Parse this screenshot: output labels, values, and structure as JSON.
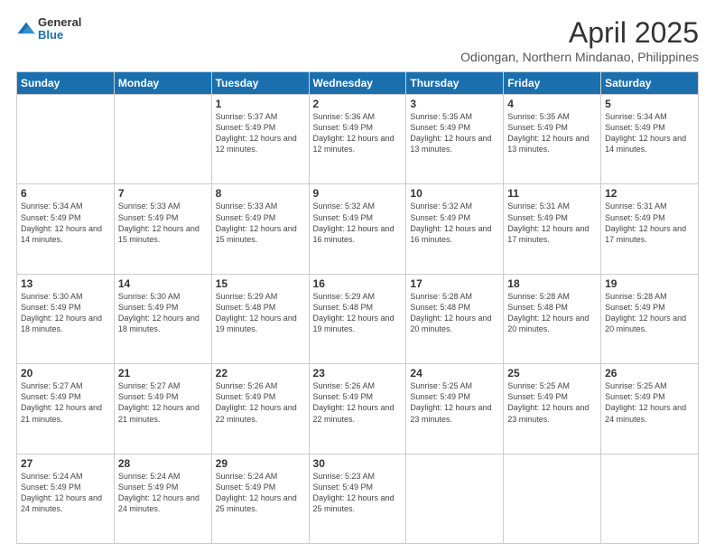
{
  "header": {
    "logo_general": "General",
    "logo_blue": "Blue",
    "title": "April 2025",
    "subtitle": "Odiongan, Northern Mindanao, Philippines"
  },
  "days_of_week": [
    "Sunday",
    "Monday",
    "Tuesday",
    "Wednesday",
    "Thursday",
    "Friday",
    "Saturday"
  ],
  "weeks": [
    [
      {
        "day": "",
        "info": ""
      },
      {
        "day": "",
        "info": ""
      },
      {
        "day": "1",
        "info": "Sunrise: 5:37 AM\nSunset: 5:49 PM\nDaylight: 12 hours and 12 minutes."
      },
      {
        "day": "2",
        "info": "Sunrise: 5:36 AM\nSunset: 5:49 PM\nDaylight: 12 hours and 12 minutes."
      },
      {
        "day": "3",
        "info": "Sunrise: 5:35 AM\nSunset: 5:49 PM\nDaylight: 12 hours and 13 minutes."
      },
      {
        "day": "4",
        "info": "Sunrise: 5:35 AM\nSunset: 5:49 PM\nDaylight: 12 hours and 13 minutes."
      },
      {
        "day": "5",
        "info": "Sunrise: 5:34 AM\nSunset: 5:49 PM\nDaylight: 12 hours and 14 minutes."
      }
    ],
    [
      {
        "day": "6",
        "info": "Sunrise: 5:34 AM\nSunset: 5:49 PM\nDaylight: 12 hours and 14 minutes."
      },
      {
        "day": "7",
        "info": "Sunrise: 5:33 AM\nSunset: 5:49 PM\nDaylight: 12 hours and 15 minutes."
      },
      {
        "day": "8",
        "info": "Sunrise: 5:33 AM\nSunset: 5:49 PM\nDaylight: 12 hours and 15 minutes."
      },
      {
        "day": "9",
        "info": "Sunrise: 5:32 AM\nSunset: 5:49 PM\nDaylight: 12 hours and 16 minutes."
      },
      {
        "day": "10",
        "info": "Sunrise: 5:32 AM\nSunset: 5:49 PM\nDaylight: 12 hours and 16 minutes."
      },
      {
        "day": "11",
        "info": "Sunrise: 5:31 AM\nSunset: 5:49 PM\nDaylight: 12 hours and 17 minutes."
      },
      {
        "day": "12",
        "info": "Sunrise: 5:31 AM\nSunset: 5:49 PM\nDaylight: 12 hours and 17 minutes."
      }
    ],
    [
      {
        "day": "13",
        "info": "Sunrise: 5:30 AM\nSunset: 5:49 PM\nDaylight: 12 hours and 18 minutes."
      },
      {
        "day": "14",
        "info": "Sunrise: 5:30 AM\nSunset: 5:49 PM\nDaylight: 12 hours and 18 minutes."
      },
      {
        "day": "15",
        "info": "Sunrise: 5:29 AM\nSunset: 5:48 PM\nDaylight: 12 hours and 19 minutes."
      },
      {
        "day": "16",
        "info": "Sunrise: 5:29 AM\nSunset: 5:48 PM\nDaylight: 12 hours and 19 minutes."
      },
      {
        "day": "17",
        "info": "Sunrise: 5:28 AM\nSunset: 5:48 PM\nDaylight: 12 hours and 20 minutes."
      },
      {
        "day": "18",
        "info": "Sunrise: 5:28 AM\nSunset: 5:48 PM\nDaylight: 12 hours and 20 minutes."
      },
      {
        "day": "19",
        "info": "Sunrise: 5:28 AM\nSunset: 5:49 PM\nDaylight: 12 hours and 20 minutes."
      }
    ],
    [
      {
        "day": "20",
        "info": "Sunrise: 5:27 AM\nSunset: 5:49 PM\nDaylight: 12 hours and 21 minutes."
      },
      {
        "day": "21",
        "info": "Sunrise: 5:27 AM\nSunset: 5:49 PM\nDaylight: 12 hours and 21 minutes."
      },
      {
        "day": "22",
        "info": "Sunrise: 5:26 AM\nSunset: 5:49 PM\nDaylight: 12 hours and 22 minutes."
      },
      {
        "day": "23",
        "info": "Sunrise: 5:26 AM\nSunset: 5:49 PM\nDaylight: 12 hours and 22 minutes."
      },
      {
        "day": "24",
        "info": "Sunrise: 5:25 AM\nSunset: 5:49 PM\nDaylight: 12 hours and 23 minutes."
      },
      {
        "day": "25",
        "info": "Sunrise: 5:25 AM\nSunset: 5:49 PM\nDaylight: 12 hours and 23 minutes."
      },
      {
        "day": "26",
        "info": "Sunrise: 5:25 AM\nSunset: 5:49 PM\nDaylight: 12 hours and 24 minutes."
      }
    ],
    [
      {
        "day": "27",
        "info": "Sunrise: 5:24 AM\nSunset: 5:49 PM\nDaylight: 12 hours and 24 minutes."
      },
      {
        "day": "28",
        "info": "Sunrise: 5:24 AM\nSunset: 5:49 PM\nDaylight: 12 hours and 24 minutes."
      },
      {
        "day": "29",
        "info": "Sunrise: 5:24 AM\nSunset: 5:49 PM\nDaylight: 12 hours and 25 minutes."
      },
      {
        "day": "30",
        "info": "Sunrise: 5:23 AM\nSunset: 5:49 PM\nDaylight: 12 hours and 25 minutes."
      },
      {
        "day": "",
        "info": ""
      },
      {
        "day": "",
        "info": ""
      },
      {
        "day": "",
        "info": ""
      }
    ]
  ]
}
